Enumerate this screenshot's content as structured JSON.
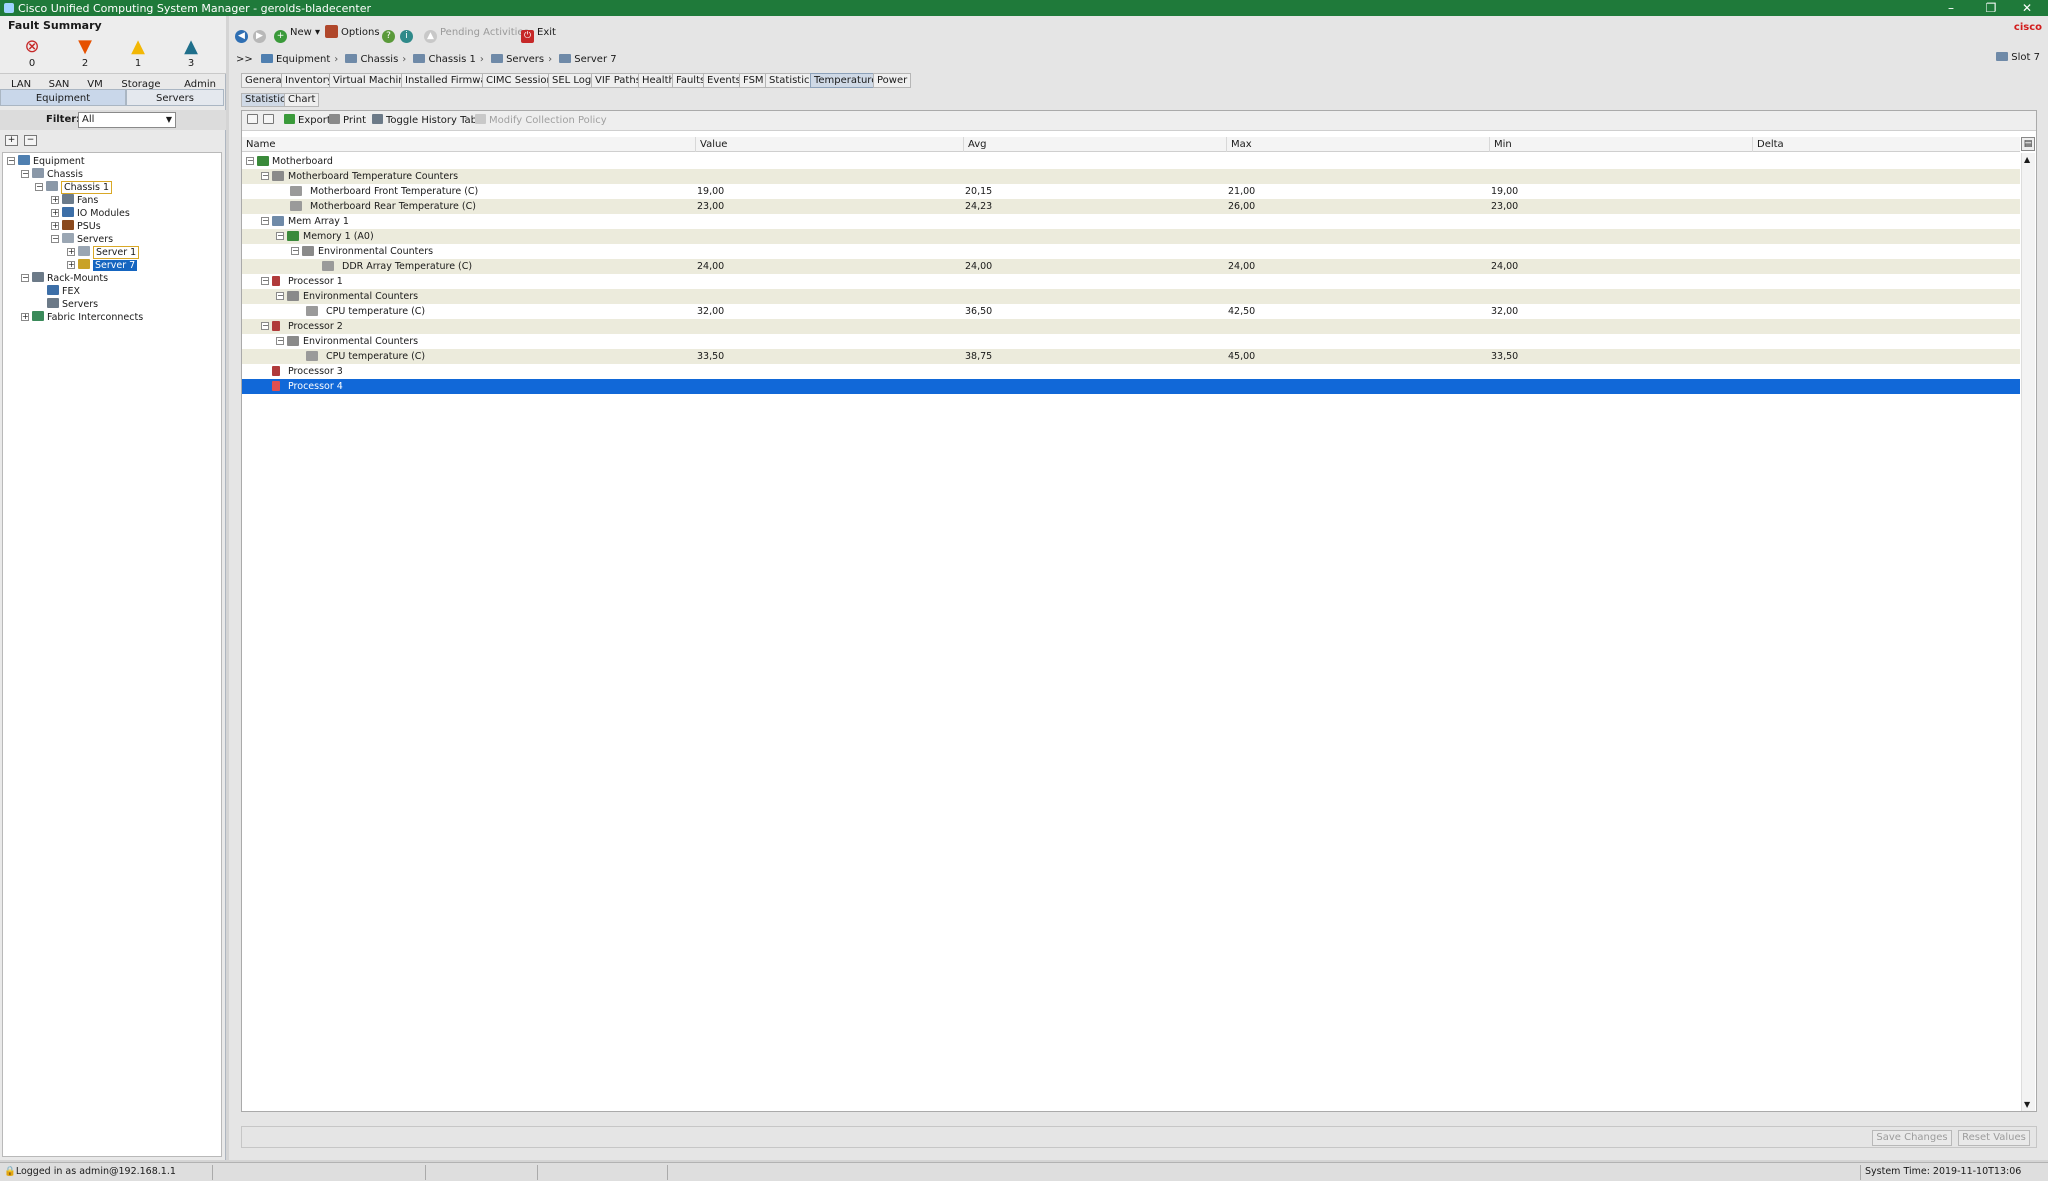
{
  "window": {
    "title": "Cisco Unified Computing System Manager - gerolds-bladecenter"
  },
  "fault_summary": {
    "title": "Fault Summary",
    "items": [
      {
        "name": "critical",
        "count": "0",
        "color": "#c62828"
      },
      {
        "name": "major",
        "count": "2",
        "color": "#e65100"
      },
      {
        "name": "minor",
        "count": "1",
        "color": "#f2b705"
      },
      {
        "name": "warning",
        "count": "3",
        "color": "#1f6f8b"
      }
    ]
  },
  "nav_tabs": [
    "LAN",
    "SAN",
    "VM",
    "Storage",
    "Admin"
  ],
  "left_tabs": [
    "Equipment",
    "Servers"
  ],
  "filter": {
    "label": "Filter:",
    "value": "All"
  },
  "tree": [
    "Equipment",
    "Chassis",
    "Chassis 1",
    "Fans",
    "IO Modules",
    "PSUs",
    "Servers",
    "Server 1",
    "Server 7",
    "Rack-Mounts",
    "FEX",
    "Servers",
    "Fabric Interconnects"
  ],
  "toolbar": {
    "new": "New",
    "options": "Options",
    "pending": "Pending Activities",
    "exit": "Exit",
    "logo": "cisco"
  },
  "breadcrumb": {
    "prefix": ">>",
    "items": [
      "Equipment",
      "Chassis",
      "Chassis 1",
      "Servers",
      "Server 7"
    ],
    "slot": "Slot 7"
  },
  "main_tabs": [
    "General",
    "Inventory",
    "Virtual Machines",
    "Installed Firmware",
    "CIMC Sessions",
    "SEL Logs",
    "VIF Paths",
    "Health",
    "Faults",
    "Events",
    "FSM",
    "Statistics",
    "Temperatures",
    "Power"
  ],
  "sub_tabs": [
    "Statistics",
    "Chart"
  ],
  "table_tools": {
    "export": "Export",
    "print": "Print",
    "toggle": "Toggle History Table",
    "modify": "Modify Collection Policy"
  },
  "columns": [
    "Name",
    "Value",
    "Avg",
    "Max",
    "Min",
    "Delta"
  ],
  "rows": [
    {
      "name": "Motherboard",
      "value": "",
      "avg": "",
      "max": "",
      "min": ""
    },
    {
      "name": "Motherboard Temperature Counters",
      "value": "",
      "avg": "",
      "max": "",
      "min": ""
    },
    {
      "name": "Motherboard Front Temperature (C)",
      "value": "19,00",
      "avg": "20,15",
      "max": "21,00",
      "min": "19,00"
    },
    {
      "name": "Motherboard Rear Temperature (C)",
      "value": "23,00",
      "avg": "24,23",
      "max": "26,00",
      "min": "23,00"
    },
    {
      "name": "Mem Array 1",
      "value": "",
      "avg": "",
      "max": "",
      "min": ""
    },
    {
      "name": "Memory 1 (A0)",
      "value": "",
      "avg": "",
      "max": "",
      "min": ""
    },
    {
      "name": "Environmental Counters",
      "value": "",
      "avg": "",
      "max": "",
      "min": ""
    },
    {
      "name": "DDR Array Temperature (C)",
      "value": "24,00",
      "avg": "24,00",
      "max": "24,00",
      "min": "24,00"
    },
    {
      "name": "Processor 1",
      "value": "",
      "avg": "",
      "max": "",
      "min": ""
    },
    {
      "name": "Environmental Counters",
      "value": "",
      "avg": "",
      "max": "",
      "min": ""
    },
    {
      "name": "CPU temperature (C)",
      "value": "32,00",
      "avg": "36,50",
      "max": "42,50",
      "min": "32,00"
    },
    {
      "name": "Processor 2",
      "value": "",
      "avg": "",
      "max": "",
      "min": ""
    },
    {
      "name": "Environmental Counters",
      "value": "",
      "avg": "",
      "max": "",
      "min": ""
    },
    {
      "name": "CPU temperature (C)",
      "value": "33,50",
      "avg": "38,75",
      "max": "45,00",
      "min": "33,50"
    },
    {
      "name": "Processor 3",
      "value": "",
      "avg": "",
      "max": "",
      "min": ""
    },
    {
      "name": "Processor 4",
      "value": "",
      "avg": "",
      "max": "",
      "min": ""
    }
  ],
  "buttons": {
    "save": "Save Changes",
    "reset": "Reset Values"
  },
  "status": {
    "login": "Logged in as admin@192.168.1.1",
    "time": "System Time: 2019-11-10T13:06"
  }
}
